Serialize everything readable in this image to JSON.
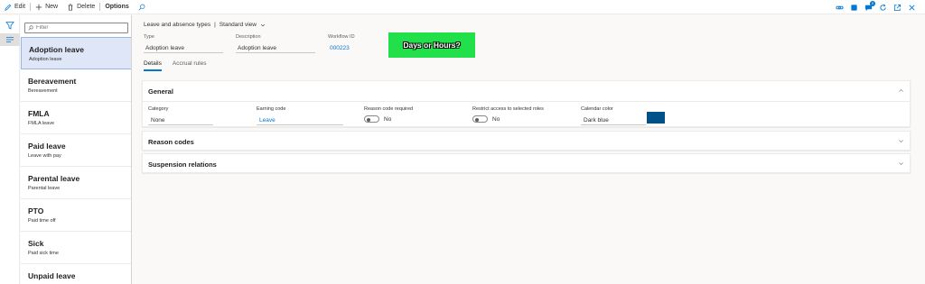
{
  "toolbar": {
    "edit": "Edit",
    "new": "New",
    "delete": "Delete",
    "options": "Options",
    "notifications_count": "0"
  },
  "filter": {
    "placeholder": "Filter"
  },
  "list": [
    {
      "name": "Adoption leave",
      "desc": "Adoption leave"
    },
    {
      "name": "Bereavement",
      "desc": "Bereavement"
    },
    {
      "name": "FMLA",
      "desc": "FMLA leave"
    },
    {
      "name": "Paid leave",
      "desc": "Leave with pay"
    },
    {
      "name": "Parental leave",
      "desc": "Parental leave"
    },
    {
      "name": "PTO",
      "desc": "Paid time off"
    },
    {
      "name": "Sick",
      "desc": "Paid sick time"
    },
    {
      "name": "Unpaid leave",
      "desc": ""
    }
  ],
  "header": {
    "breadcrumb": "Leave and absence types",
    "separator": "|",
    "view": "Standard view",
    "type_label": "Type",
    "type_value": "Adoption leave",
    "description_label": "Description",
    "description_value": "Adoption leave",
    "workflow_label": "Workflow ID",
    "workflow_value": "000223",
    "callout": "Days or Hours?"
  },
  "tabs": [
    "Details",
    "Accrual rules"
  ],
  "general": {
    "title": "General",
    "category_label": "Category",
    "category_value": "None",
    "earning_label": "Earning code",
    "earning_value": "Leave",
    "reason_label": "Reason code required",
    "reason_value": "No",
    "restrict_label": "Restrict access to selected roles",
    "restrict_value": "No",
    "color_label": "Calendar color",
    "color_value": "Dark blue",
    "color_hex": "#00508a"
  },
  "sections": {
    "reason_codes": "Reason codes",
    "suspension": "Suspension relations"
  },
  "colors": {
    "accent": "#0078d4",
    "selected_bg": "#dfe6f7",
    "callout_bg": "#22e04a"
  }
}
